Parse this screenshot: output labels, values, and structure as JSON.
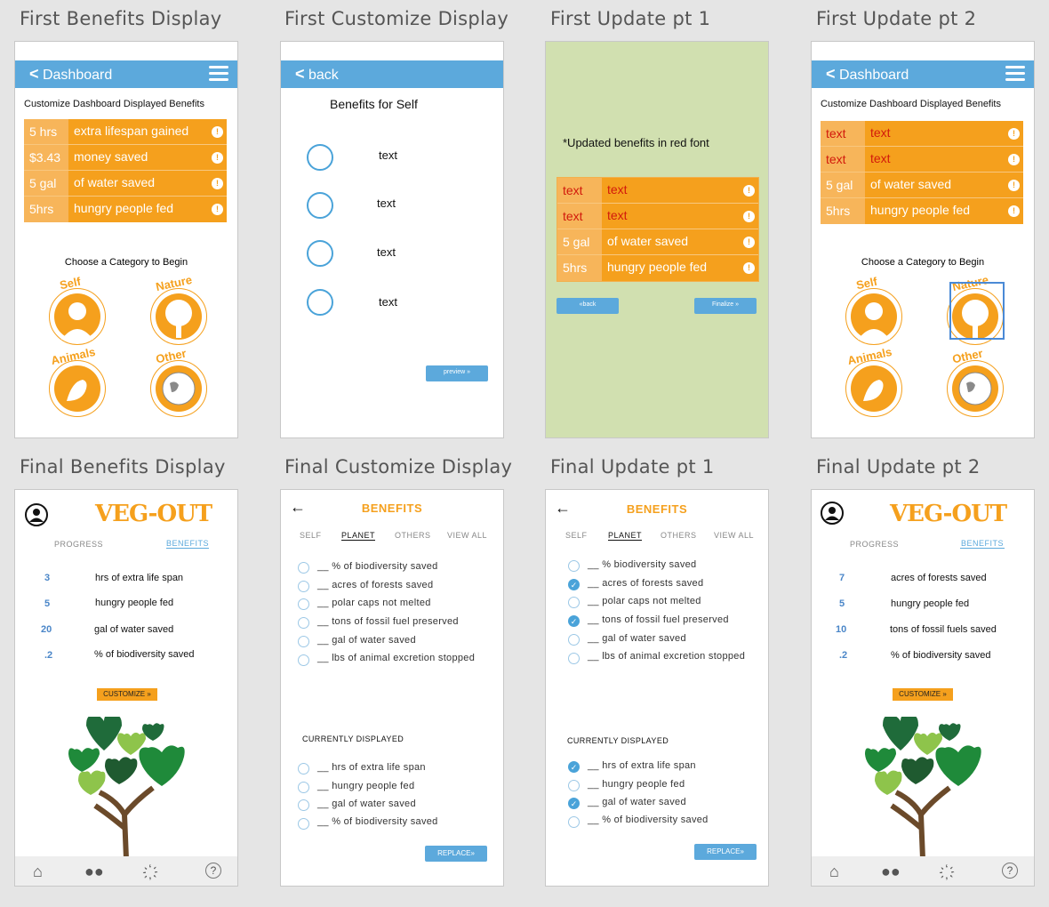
{
  "captions": [
    "First Benefits Display",
    "First Customize Display",
    "First Update pt 1",
    "First Update pt 2",
    "Final Benefits Display",
    "Final Customize Display",
    "Final Update pt 1",
    "Final Update pt 2"
  ],
  "first_benefits": {
    "nav": "Dashboard",
    "subtitle": "Customize Dashboard Displayed Benefits",
    "rows": [
      {
        "num": "5 hrs",
        "text": "extra lifespan gained"
      },
      {
        "num": "$3.43",
        "text": "money saved"
      },
      {
        "num": "5 gal",
        "text": "of water saved"
      },
      {
        "num": "5hrs",
        "text": "hungry people fed"
      }
    ],
    "choose": "Choose a Category to Begin",
    "cats": [
      "Self",
      "Nature",
      "Animals",
      "Other"
    ]
  },
  "first_customize": {
    "nav": "back",
    "heading": "Benefits for Self",
    "options": [
      "text",
      "text",
      "text",
      "text"
    ],
    "preview": "preview »"
  },
  "first_update1": {
    "note": "*Updated benefits in red font",
    "rows": [
      {
        "num": "text",
        "text": "text",
        "red": true
      },
      {
        "num": "text",
        "text": "text",
        "red": true
      },
      {
        "num": "5 gal",
        "text": "of water saved",
        "red": false
      },
      {
        "num": "5hrs",
        "text": "hungry people fed",
        "red": false
      }
    ],
    "back": "«back",
    "finalize": "Finalize »"
  },
  "first_update2": {
    "nav": "Dashboard",
    "subtitle": "Customize Dashboard Displayed Benefits",
    "rows": [
      {
        "num": "text",
        "text": "text",
        "red": true
      },
      {
        "num": "text",
        "text": "text",
        "red": true
      },
      {
        "num": "5 gal",
        "text": "of water saved",
        "red": false
      },
      {
        "num": "5hrs",
        "text": "hungry people fed",
        "red": false
      }
    ],
    "choose": "Choose a Category to Begin",
    "cats": [
      "Self",
      "Nature",
      "Animals",
      "Other"
    ]
  },
  "final_benefits": {
    "logo": "VEG-OUT",
    "tabs": [
      "PROGRESS",
      "BENEFITS"
    ],
    "stats": [
      {
        "n": "3",
        "t": "hrs of extra life span"
      },
      {
        "n": "5",
        "t": "hungry people fed"
      },
      {
        "n": "20",
        "t": "gal of water saved"
      },
      {
        "n": ".2",
        "t": "% of biodiversity saved"
      }
    ],
    "customize": "CUSTOMIZE »"
  },
  "final_customize": {
    "title": "BENEFITS",
    "tabs": [
      "SELF",
      "PLANET",
      "OTHERS",
      "VIEW ALL"
    ],
    "options": [
      "__ % of biodiversity saved",
      "__ acres of forests saved",
      "__ polar caps not melted",
      "__ tons of fossil fuel preserved",
      "__ gal of water saved",
      "__ lbs of animal excretion stopped"
    ],
    "current_label": "CURRENTLY DISPLAYED",
    "current": [
      "__ hrs of extra life span",
      "__ hungry people fed",
      "__ gal of water saved",
      "__ % of biodiversity saved"
    ],
    "replace": "REPLACE»"
  },
  "final_update1": {
    "title": "BENEFITS",
    "tabs": [
      "SELF",
      "PLANET",
      "OTHERS",
      "VIEW ALL"
    ],
    "options": [
      "__ % biodiversity saved",
      "__ acres of forests saved",
      "__ polar caps not melted",
      "__ tons of fossil fuel preserved",
      "__ gal of water saved",
      "__ lbs of animal excretion stopped"
    ],
    "checked": [
      false,
      true,
      false,
      true,
      false,
      false
    ],
    "current_label": "CURRENTLY DISPLAYED",
    "current": [
      "__ hrs of extra life span",
      "__ hungry people fed",
      "__ gal of water saved",
      "__ % of biodiversity saved"
    ],
    "current_checked": [
      true,
      false,
      true,
      false
    ],
    "replace": "REPLACE»"
  },
  "final_update2": {
    "logo": "VEG-OUT",
    "tabs": [
      "PROGRESS",
      "BENEFITS"
    ],
    "stats": [
      {
        "n": "7",
        "t": "acres of forests saved"
      },
      {
        "n": "5",
        "t": "hungry people fed"
      },
      {
        "n": "10",
        "t": "tons of fossil fuels saved"
      },
      {
        "n": ".2",
        "t": "% of biodiversity saved"
      }
    ],
    "customize": "CUSTOMIZE »"
  },
  "icons": [
    "back-chevron-icon",
    "hamburger-icon",
    "info-icon",
    "home-icon",
    "people-icon",
    "utensils-icon",
    "help-icon",
    "user-avatar-icon",
    "arrow-left-icon",
    "check-icon",
    "tree-hearts-illustration"
  ]
}
